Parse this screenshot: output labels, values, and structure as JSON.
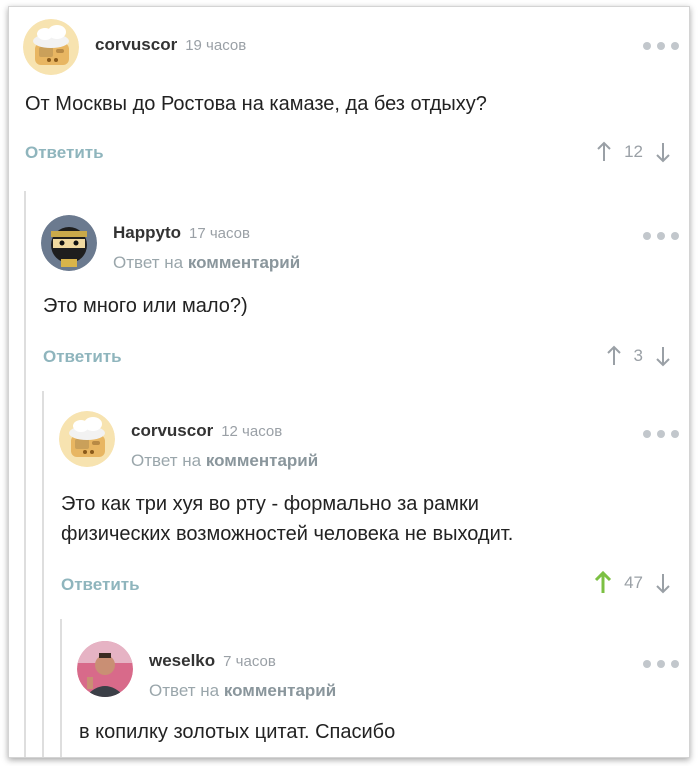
{
  "comments": [
    {
      "username": "corvuscor",
      "time": "19 часов",
      "text": "От Москвы до Ростова на камазе, да без отдыху?",
      "reply_label": "Ответить",
      "rating": "12",
      "avatar": "toaster-avatar",
      "upvoted": false
    },
    {
      "username": "Happyto",
      "time": "17 часов",
      "reply_to_prefix": "Ответ на",
      "reply_to_link": "комментарий",
      "text": "Это много или мало?)",
      "reply_label": "Ответить",
      "rating": "3",
      "avatar": "ninja-avatar",
      "upvoted": false
    },
    {
      "username": "corvuscor",
      "time": "12 часов",
      "reply_to_prefix": "Ответ на",
      "reply_to_link": "комментарий",
      "text_line1": "Это как три хуя во рту - формально за рамки",
      "text_line2": "физических возможностей человека не выходит.",
      "reply_label": "Ответить",
      "rating": "47",
      "avatar": "toaster-avatar",
      "upvoted": true
    },
    {
      "username": "weselko",
      "time": "7 часов",
      "reply_to_prefix": "Ответ на",
      "reply_to_link": "комментарий",
      "text": "в копилку золотых цитат. Спасибо",
      "avatar": "photo-avatar"
    }
  ],
  "colors": {
    "upvote_active": "#7cc043",
    "reply_link": "#8fb5bd",
    "thread_line": "#dedede"
  }
}
